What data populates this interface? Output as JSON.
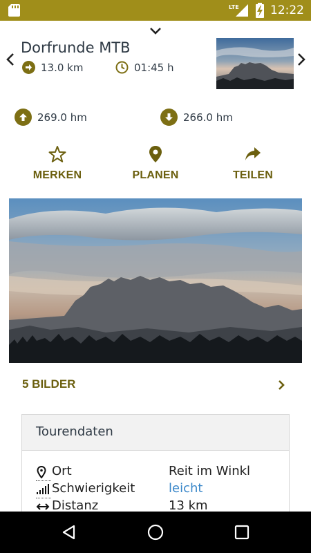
{
  "status_bar": {
    "network": "LTE",
    "time": "12:22"
  },
  "tour": {
    "name": "Dorfrunde MTB",
    "distance": "13.0 km",
    "duration": "01:45 h",
    "ascent": "269.0 hm",
    "descent": "266.0 hm"
  },
  "actions": [
    {
      "label": "MERKEN",
      "icon": "star-icon"
    },
    {
      "label": "PLANEN",
      "icon": "location-pin-icon"
    },
    {
      "label": "TEILEN",
      "icon": "share-icon"
    }
  ],
  "gallery": {
    "label": "5 BILDER"
  },
  "tour_data": {
    "title": "Tourendaten",
    "rows": [
      {
        "key": "Ort",
        "value": "Reit im Winkl",
        "icon": "location-pin-icon"
      },
      {
        "key": "Schwierigkeit",
        "value": "leicht",
        "icon": "signal-bars-icon"
      },
      {
        "key": "Distanz",
        "value": "13 km",
        "icon": "double-arrow-icon"
      }
    ]
  },
  "colors": {
    "accent": "#a08e1a",
    "accent_dark": "#6b5f0e",
    "link": "#3a87c9"
  }
}
